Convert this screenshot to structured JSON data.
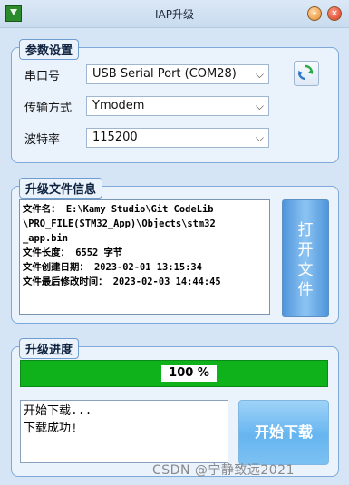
{
  "window": {
    "title": "IAP升级",
    "min_glyph": "–",
    "close_glyph": "×"
  },
  "params": {
    "legend": "参数设置",
    "port": {
      "label": "串口号",
      "value": "USB Serial Port (COM28)"
    },
    "mode": {
      "label": "传输方式",
      "value": "Ymodem"
    },
    "baud": {
      "label": "波特率",
      "value": "115200"
    },
    "refresh_icon": "refresh-icon"
  },
  "fileinfo": {
    "legend": "升级文件信息",
    "lines": [
      "文件名： E:\\Kamy Studio\\Git CodeLib",
      "\\PRO_FILE(STM32_App)\\Objects\\stm32",
      "_app.bin",
      "文件长度： 6552 字节",
      "文件创建日期： 2023-02-01 13:15:34",
      "文件最后修改时间： 2023-02-03 14:44:45"
    ],
    "open_button_chars": [
      "打",
      "开",
      "文",
      "件"
    ]
  },
  "progress": {
    "legend": "升级进度",
    "percent_text": "100 %",
    "value": 1.0,
    "log_lines": [
      "开始下载...",
      "下载成功!"
    ],
    "download_button": "开始下载"
  },
  "watermark": "CSDN @宁静致远2021"
}
